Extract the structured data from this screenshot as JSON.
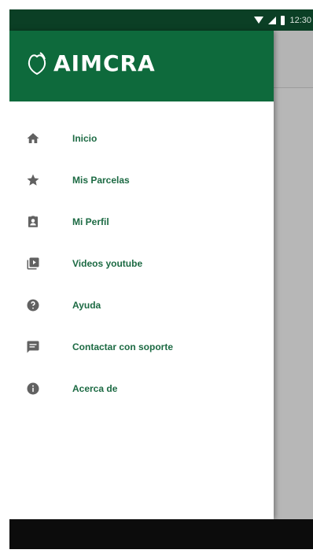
{
  "status_bar": {
    "time": "12:30"
  },
  "drawer": {
    "logo_text": "AIMCRA",
    "items": [
      {
        "label": "Inicio",
        "icon": "home-icon"
      },
      {
        "label": "Mis Parcelas",
        "icon": "star-icon"
      },
      {
        "label": "Mi Perfil",
        "icon": "profile-badge-icon"
      },
      {
        "label": "Videos youtube",
        "icon": "video-library-icon"
      },
      {
        "label": "Ayuda",
        "icon": "help-icon"
      },
      {
        "label": "Contactar con soporte",
        "icon": "feedback-icon"
      },
      {
        "label": "Acerca de",
        "icon": "info-icon"
      }
    ]
  },
  "colors": {
    "header_green": "#0e6a3c",
    "status_bar": "#0b3f25",
    "label_green": "#1c6a43",
    "icon_gray": "#616161"
  }
}
